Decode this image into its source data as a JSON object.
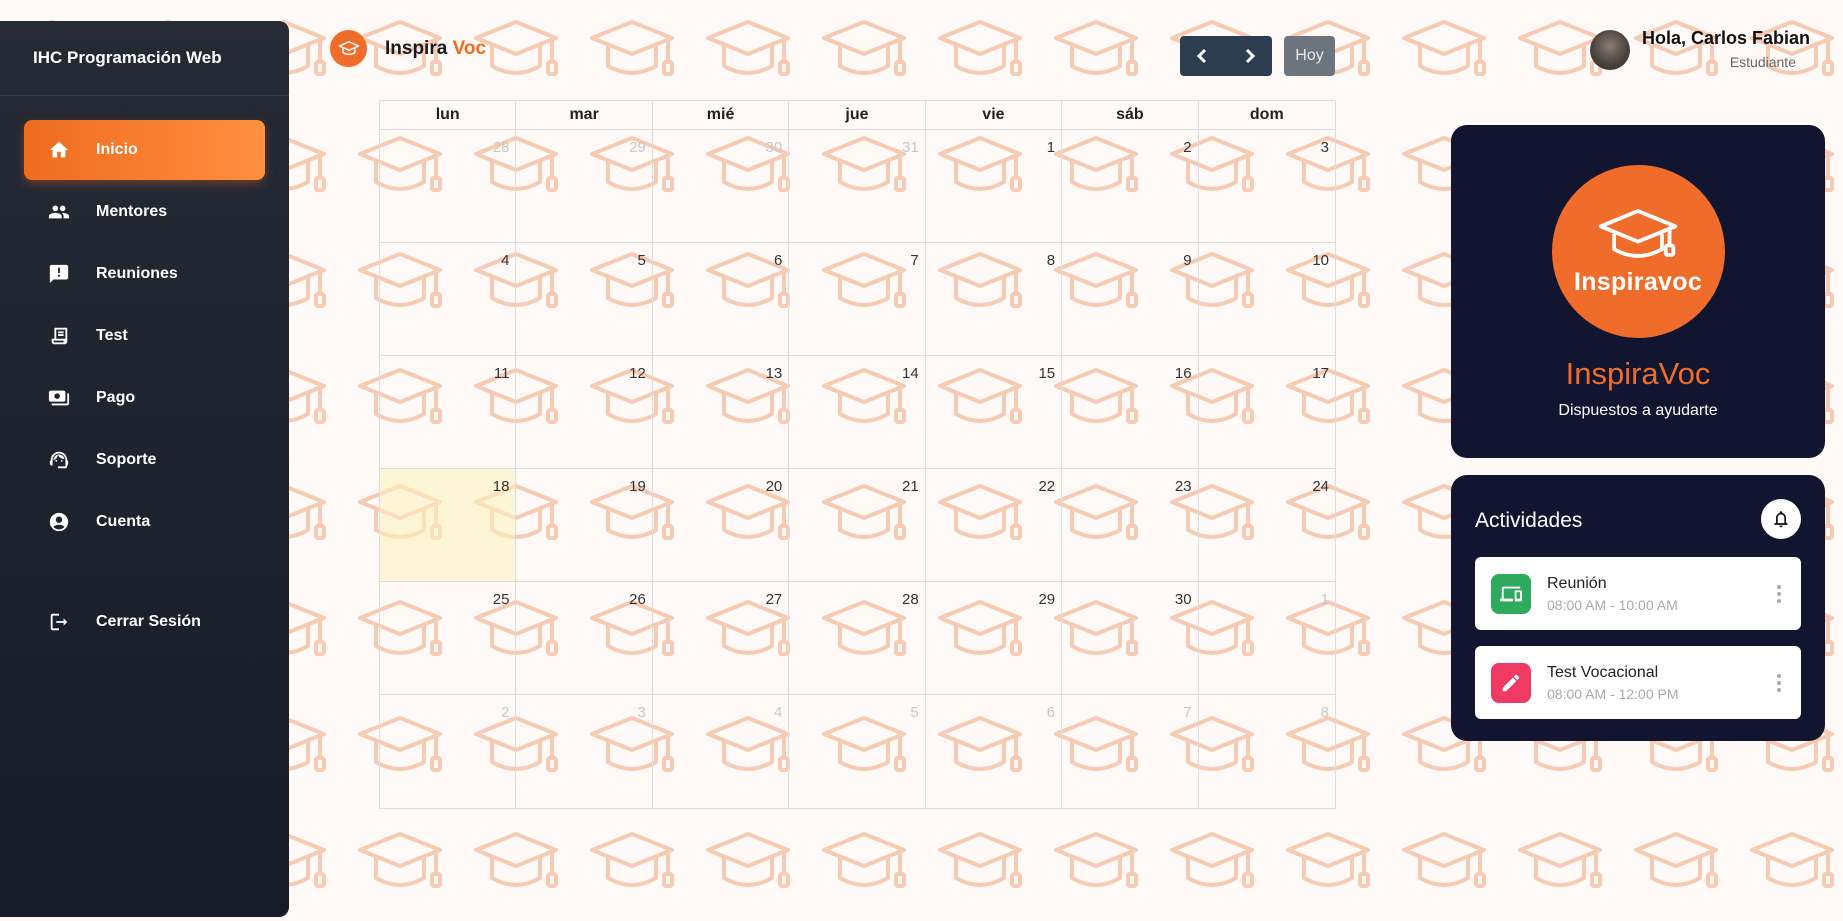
{
  "colors": {
    "accent": "#ef6c1f",
    "sidebar_bg": "#1d2130",
    "panel_bg": "#111530",
    "nav_button_bg": "#2c3e50",
    "today_button_bg": "#6c757d",
    "today_highlight": "#fdf3cd",
    "activity_green": "#2eaa5c",
    "activity_pink": "#f03a63"
  },
  "sidebar": {
    "title": "IHC Programación Web",
    "items": [
      {
        "label": "Inicio",
        "icon": "home-icon",
        "active": true
      },
      {
        "label": "Mentores",
        "icon": "people-icon"
      },
      {
        "label": "Reuniones",
        "icon": "chat-icon"
      },
      {
        "label": "Test",
        "icon": "receipt-icon"
      },
      {
        "label": "Pago",
        "icon": "payment-icon"
      },
      {
        "label": "Soporte",
        "icon": "support-icon"
      },
      {
        "label": "Cuenta",
        "icon": "account-icon"
      }
    ],
    "logout_label": "Cerrar Sesión"
  },
  "brand": {
    "logo_text": "Inspiravoc",
    "name_prefix": "Inspira",
    "name_suffix": "Voc"
  },
  "calendar_nav": {
    "prev_icon": "chevron-left-icon",
    "next_icon": "chevron-right-icon",
    "today_label": "Hoy"
  },
  "user": {
    "greeting": "Hola, Carlos Fabian",
    "role": "Estudiante"
  },
  "calendar": {
    "weekdays": [
      "lun",
      "mar",
      "mié",
      "jue",
      "vie",
      "sáb",
      "dom"
    ],
    "today": 18,
    "weeks": [
      [
        {
          "d": "28",
          "m": true
        },
        {
          "d": "29",
          "m": true
        },
        {
          "d": "30",
          "m": true
        },
        {
          "d": "31",
          "m": true
        },
        {
          "d": "1"
        },
        {
          "d": "2"
        },
        {
          "d": "3"
        }
      ],
      [
        {
          "d": "4"
        },
        {
          "d": "5"
        },
        {
          "d": "6"
        },
        {
          "d": "7"
        },
        {
          "d": "8"
        },
        {
          "d": "9"
        },
        {
          "d": "10"
        }
      ],
      [
        {
          "d": "11"
        },
        {
          "d": "12"
        },
        {
          "d": "13"
        },
        {
          "d": "14"
        },
        {
          "d": "15"
        },
        {
          "d": "16"
        },
        {
          "d": "17"
        }
      ],
      [
        {
          "d": "18",
          "t": true
        },
        {
          "d": "19"
        },
        {
          "d": "20"
        },
        {
          "d": "21"
        },
        {
          "d": "22"
        },
        {
          "d": "23"
        },
        {
          "d": "24"
        }
      ],
      [
        {
          "d": "25"
        },
        {
          "d": "26"
        },
        {
          "d": "27"
        },
        {
          "d": "28"
        },
        {
          "d": "29"
        },
        {
          "d": "30"
        },
        {
          "d": "1",
          "m": true
        }
      ],
      [
        {
          "d": "2",
          "m": true
        },
        {
          "d": "3",
          "m": true
        },
        {
          "d": "4",
          "m": true
        },
        {
          "d": "5",
          "m": true
        },
        {
          "d": "6",
          "m": true
        },
        {
          "d": "7",
          "m": true
        },
        {
          "d": "8",
          "m": true
        }
      ]
    ]
  },
  "brand_card": {
    "logo_word": "Inspiravoc",
    "title": "InspiraVoc",
    "subtitle": "Dispuestos a ayudarte"
  },
  "activities": {
    "title": "Actividades",
    "bell_icon": "bell-icon",
    "items": [
      {
        "name": "Reunión",
        "time": "08:00 AM - 10:00 AM",
        "icon": "devices-icon",
        "color": "#2eaa5c"
      },
      {
        "name": "Test Vocacional",
        "time": "08:00 AM - 12:00 PM",
        "icon": "pencil-icon",
        "color": "#f03a63"
      }
    ]
  }
}
